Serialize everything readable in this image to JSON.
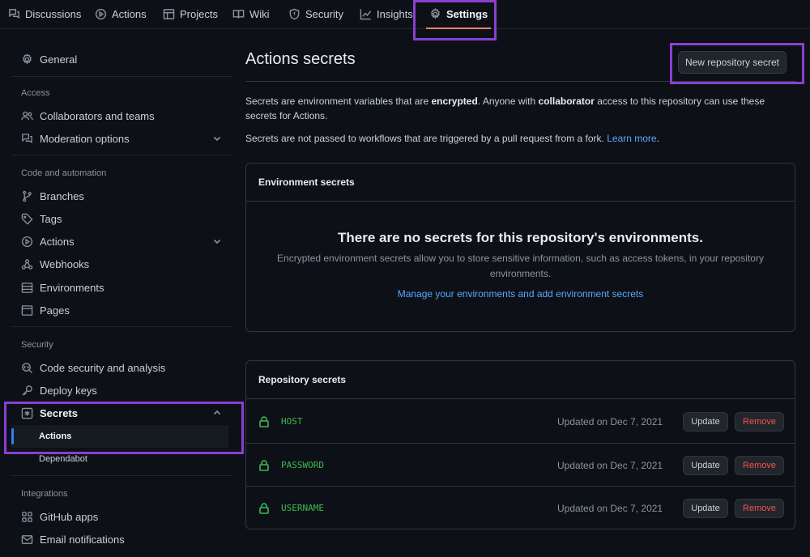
{
  "nav": {
    "tabs": [
      {
        "label": "Discussions",
        "icon": "comment-discussion-icon"
      },
      {
        "label": "Actions",
        "icon": "play-icon"
      },
      {
        "label": "Projects",
        "icon": "table-icon"
      },
      {
        "label": "Wiki",
        "icon": "book-icon"
      },
      {
        "label": "Security",
        "icon": "shield-icon"
      },
      {
        "label": "Insights",
        "icon": "graph-icon"
      },
      {
        "label": "Settings",
        "icon": "gear-icon",
        "active": true
      }
    ]
  },
  "sidebar": {
    "general": "General",
    "sections": {
      "access": "Access",
      "code_automation": "Code and automation",
      "security": "Security",
      "integrations": "Integrations"
    },
    "items": {
      "collaborators": "Collaborators and teams",
      "moderation": "Moderation options",
      "branches": "Branches",
      "tags": "Tags",
      "actions": "Actions",
      "webhooks": "Webhooks",
      "environments": "Environments",
      "pages": "Pages",
      "code_security": "Code security and analysis",
      "deploy_keys": "Deploy keys",
      "secrets": "Secrets",
      "secrets_actions": "Actions",
      "secrets_dependabot": "Dependabot",
      "github_apps": "GitHub apps",
      "email_notifications": "Email notifications"
    }
  },
  "main": {
    "title": "Actions secrets",
    "new_button": "New repository secret",
    "intro": {
      "part1": "Secrets are environment variables that are ",
      "bold1": "encrypted",
      "part2": ". Anyone with ",
      "bold2": "collaborator",
      "part3": " access to this repository can use these secrets for Actions."
    },
    "fork_note": "Secrets are not passed to workflows that are triggered by a pull request from a fork. ",
    "learn_more": "Learn more",
    "environment_box": {
      "heading": "Environment secrets",
      "empty_title": "There are no secrets for this repository's environments.",
      "empty_desc": "Encrypted environment secrets allow you to store sensitive information, such as access tokens, in your repository environments.",
      "manage_link": "Manage your environments and add environment secrets"
    },
    "repository_box": {
      "heading": "Repository secrets",
      "update_label": "Update",
      "remove_label": "Remove",
      "secrets": [
        {
          "name": "HOST",
          "updated": "Updated on Dec 7, 2021"
        },
        {
          "name": "PASSWORD",
          "updated": "Updated on Dec 7, 2021"
        },
        {
          "name": "USERNAME",
          "updated": "Updated on Dec 7, 2021"
        }
      ]
    }
  },
  "colors": {
    "background": "#0d1117",
    "accent_tab_underline": "#f78166",
    "highlight_box": "#8a3fd1",
    "link": "#58a6ff",
    "secret_green": "#3fb950",
    "danger": "#f85149"
  }
}
